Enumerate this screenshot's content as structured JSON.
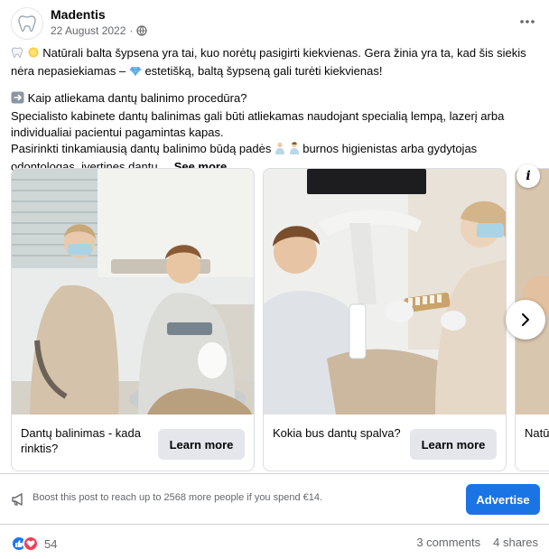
{
  "post": {
    "page_name": "Madentis",
    "date": "22 August 2022",
    "dot": "·",
    "paragraph1_icons": [
      "tooth-emoji",
      "sun-emoji"
    ],
    "paragraph1_a": "Natūrali balta šypsena yra tai, kuo norėtų pasigirti kiekvienas. Gera žinia yra ta, kad šis siekis nėra nepasiekiamas –",
    "paragraph1_b": "estetišką, baltą šypseną gali turėti kiekvienas!",
    "question": "Kaip atliekama dantų balinimo procedūra?",
    "paragraph2": "Specialisto kabinete dantų balinimas gali būti atliekamas naudojant specialią lempą, lazerį arba individualiai pacientui pagamintas kapas.",
    "paragraph3_a": "Pasirinkti tinkamiausią dantų balinimo būdą padės",
    "paragraph3_b": "burnos higienistas arba gydytojas odontologas, įvertinęs dantų ...",
    "see_more": "See more"
  },
  "carousel": {
    "cards": [
      {
        "title": "Dantų balinimas - kada rinktis?",
        "button": "Learn more"
      },
      {
        "title": "Kokia bus dantų spalva?",
        "button": "Learn more"
      },
      {
        "title": "Natū",
        "button": ""
      }
    ]
  },
  "boost": {
    "text": "Boost this post to reach up to 2568 more people if you spend €14.",
    "button": "Advertise"
  },
  "engagement": {
    "reactions_count": "54",
    "comments": "3 comments",
    "shares": "4 shares"
  },
  "colors": {
    "accent": "#1b74e4",
    "like": "#1877f2",
    "love": "#f33e58"
  }
}
